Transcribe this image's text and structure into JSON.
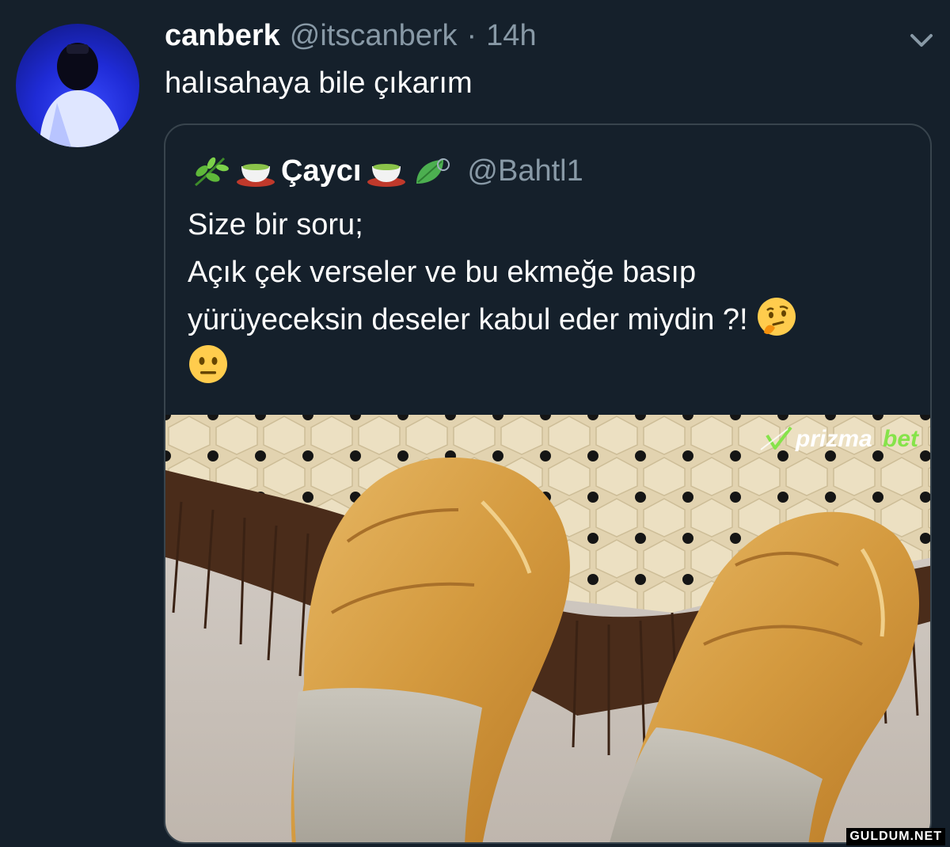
{
  "tweet": {
    "display_name": "canberk",
    "handle": "@itscanberk",
    "separator": "·",
    "time": "14h",
    "text": "halısahaya bile çıkarım"
  },
  "quote": {
    "display_name": "Çaycı",
    "handle": "@Bahtl1",
    "text_lines": [
      "Size bir soru;",
      "Açık çek verseler ve bu ekmeğe basıp",
      "yürüyeceksin deseler kabul eder miydin ?!"
    ],
    "name_icons": [
      "herb-icon",
      "tea-icon",
      "tea-icon",
      "leaf-icon"
    ],
    "text_emojis": [
      "thinking-face-icon",
      "neutral-face-icon"
    ]
  },
  "media": {
    "watermark_part1": "prizma",
    "watermark_part2": "bet",
    "colors": {
      "accent": "#86e34a",
      "bread": "#d9a04a",
      "rug": "#e2d3b0"
    }
  },
  "site_watermark": "GULDUM.NET"
}
